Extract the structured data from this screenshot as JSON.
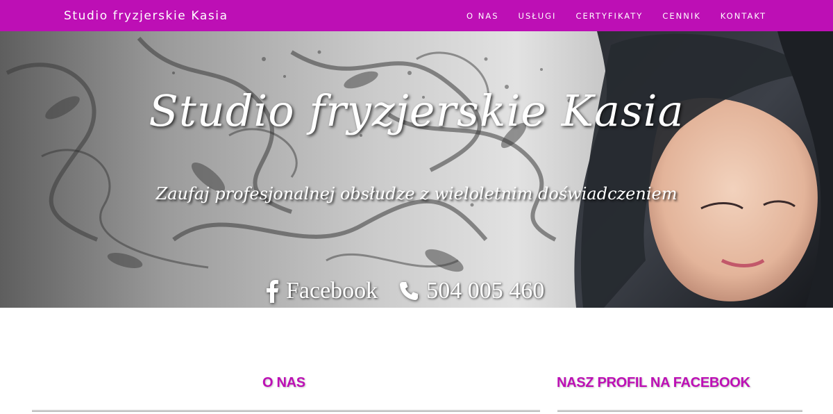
{
  "navbar": {
    "brand": "Studio fryzjerskie Kasia",
    "links": [
      "O NAS",
      "USŁUGI",
      "CERTYFIKATY",
      "CENNIK",
      "KONTAKT"
    ],
    "background": "#bd0fb5"
  },
  "hero": {
    "title": "Studio fryzjerskie Kasia",
    "subtitle": "Zaufaj profesjonalnej obsłudze z wieloletnim doświadczeniem",
    "facebook_label": "Facebook",
    "phone": "504 005 460",
    "icons": [
      "facebook-icon",
      "phone-icon"
    ]
  },
  "sections": {
    "about_title": "O NAS",
    "facebook_title": "NASZ PROFIL NA FACEBOOK"
  },
  "colors": {
    "accent": "#bd0fb5",
    "divider": "#cfcfcf"
  }
}
